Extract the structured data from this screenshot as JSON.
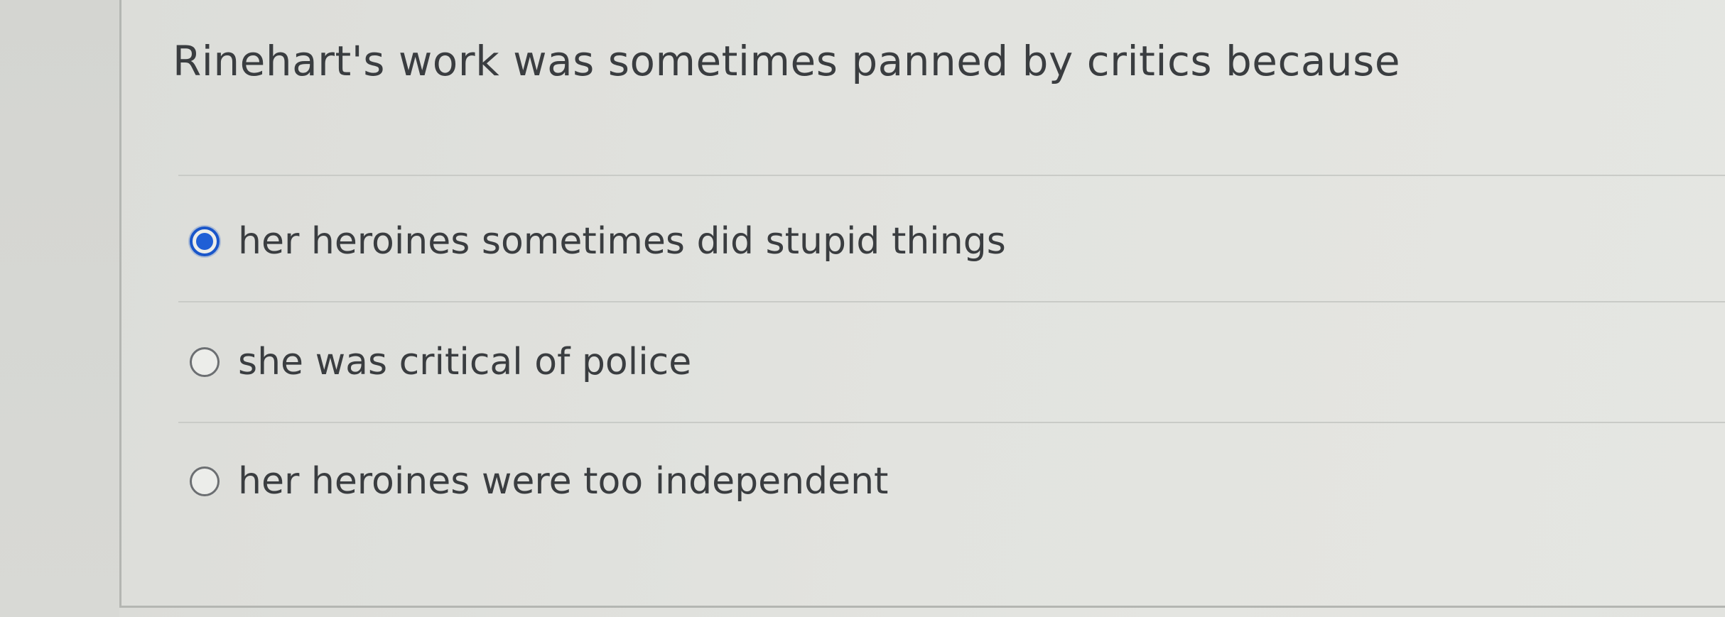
{
  "question": {
    "text": "Rinehart's work was sometimes panned by critics because"
  },
  "options": [
    {
      "label": "her heroines sometimes did stupid things",
      "selected": true
    },
    {
      "label": "she was critical of police",
      "selected": false
    },
    {
      "label": "her heroines were too independent",
      "selected": false
    }
  ],
  "colors": {
    "selected_radio": "#1f5fd6",
    "text": "#3a3d40"
  }
}
